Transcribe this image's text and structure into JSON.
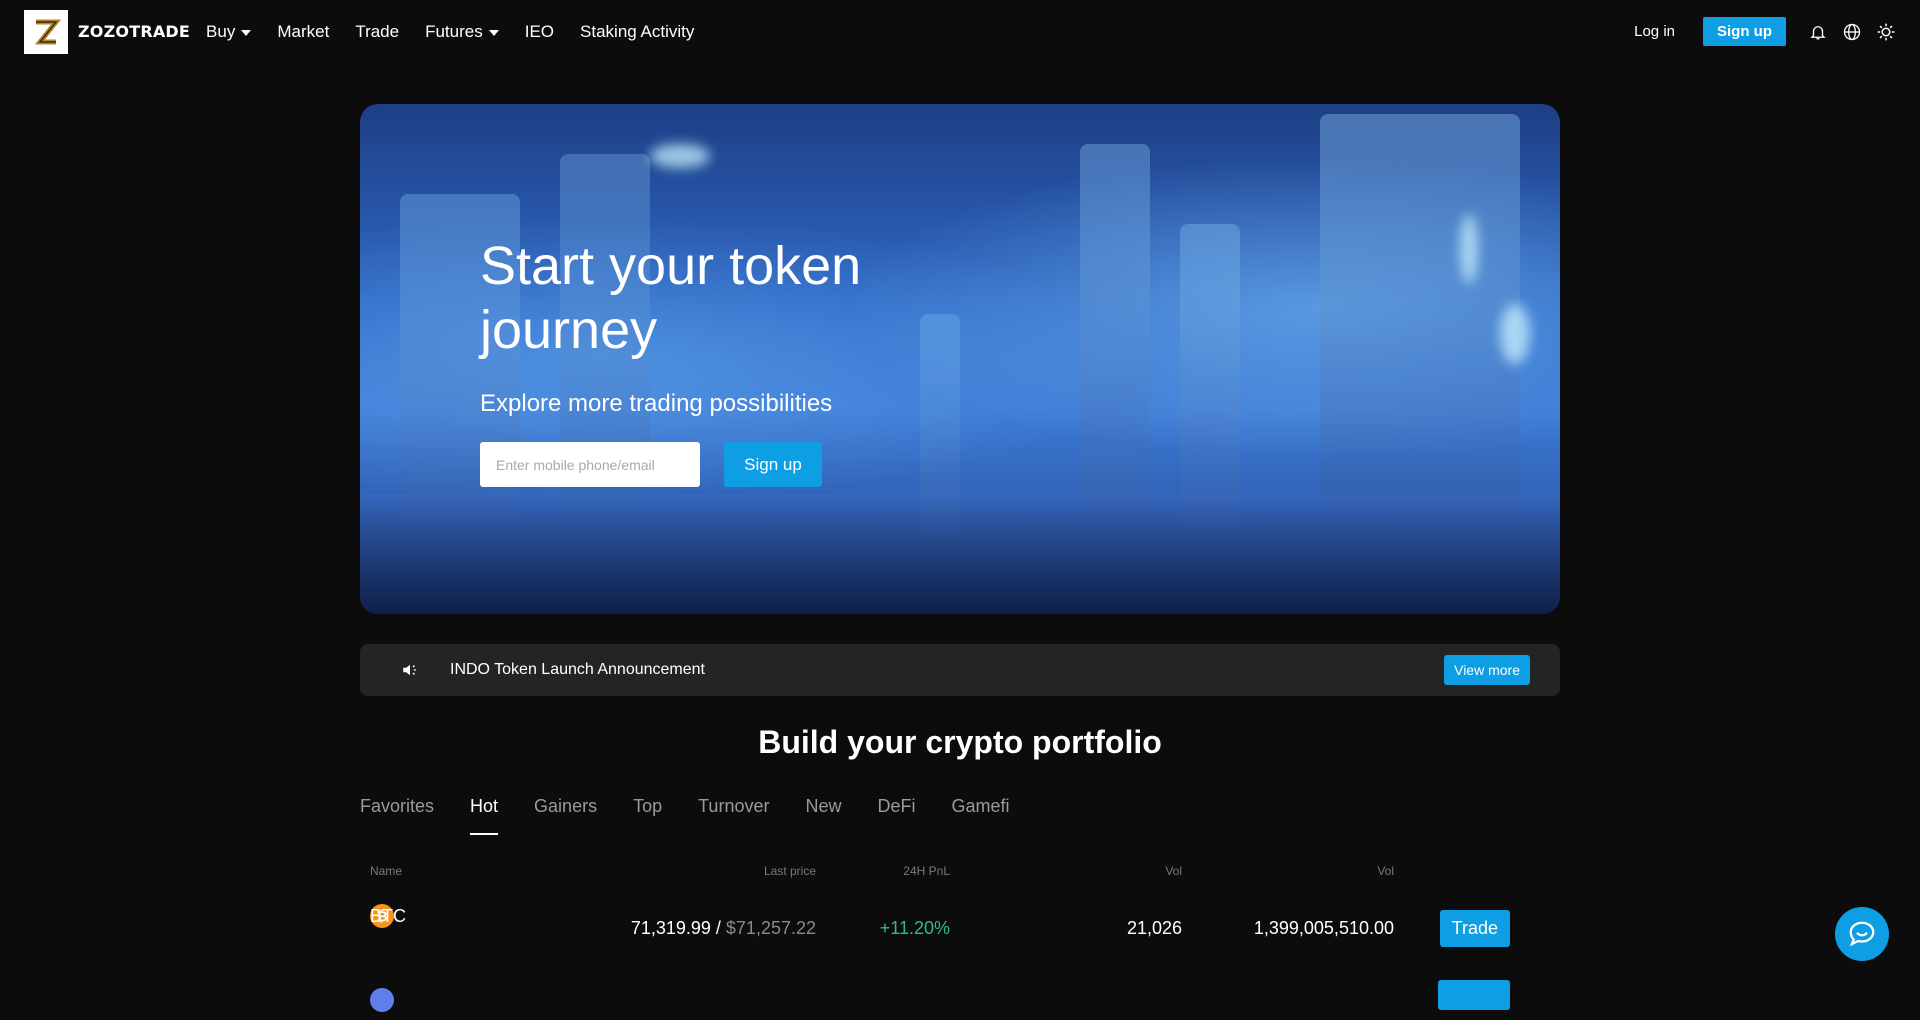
{
  "nav": {
    "logo_text": "ZOZOTRADE",
    "menu": [
      {
        "label": "Buy",
        "dropdown": true
      },
      {
        "label": "Market",
        "dropdown": false
      },
      {
        "label": "Trade",
        "dropdown": false
      },
      {
        "label": "Futures",
        "dropdown": true
      },
      {
        "label": "IEO",
        "dropdown": false
      },
      {
        "label": "Staking Activity",
        "dropdown": false
      }
    ],
    "login_label": "Log in",
    "signup_label": "Sign up",
    "icons": [
      "bell-icon",
      "globe-icon",
      "sun-icon"
    ]
  },
  "hero": {
    "title": "Start your token journey",
    "subtitle": "Explore more trading possibilities",
    "input_placeholder": "Enter mobile phone/email",
    "button_label": "Sign up"
  },
  "announcement": {
    "text": "INDO Token Launch Announcement",
    "button_label": "View more"
  },
  "portfolio": {
    "title": "Build your crypto portfolio",
    "tabs": [
      "Favorites",
      "Hot",
      "Gainers",
      "Top",
      "Turnover",
      "New",
      "DeFi",
      "Gamefi"
    ],
    "active_tab": "Hot",
    "columns": [
      "Name",
      "Last price",
      "24H PnL",
      "Vol",
      "Vol"
    ],
    "rows": [
      {
        "symbol": "BTC",
        "price": "71,319.99",
        "price_usd": "$71,257.22",
        "pnl": "+11.20%",
        "vol": "21,026",
        "turnover": "1,399,005,510.00",
        "action": "Trade"
      },
      {
        "symbol": "",
        "price": "",
        "price_usd": "",
        "pnl": "",
        "vol": "",
        "turnover": "",
        "action": ""
      }
    ]
  },
  "colors": {
    "accent": "#0d9ee4",
    "positive": "#2dbd85",
    "background": "#0c0c0d"
  }
}
